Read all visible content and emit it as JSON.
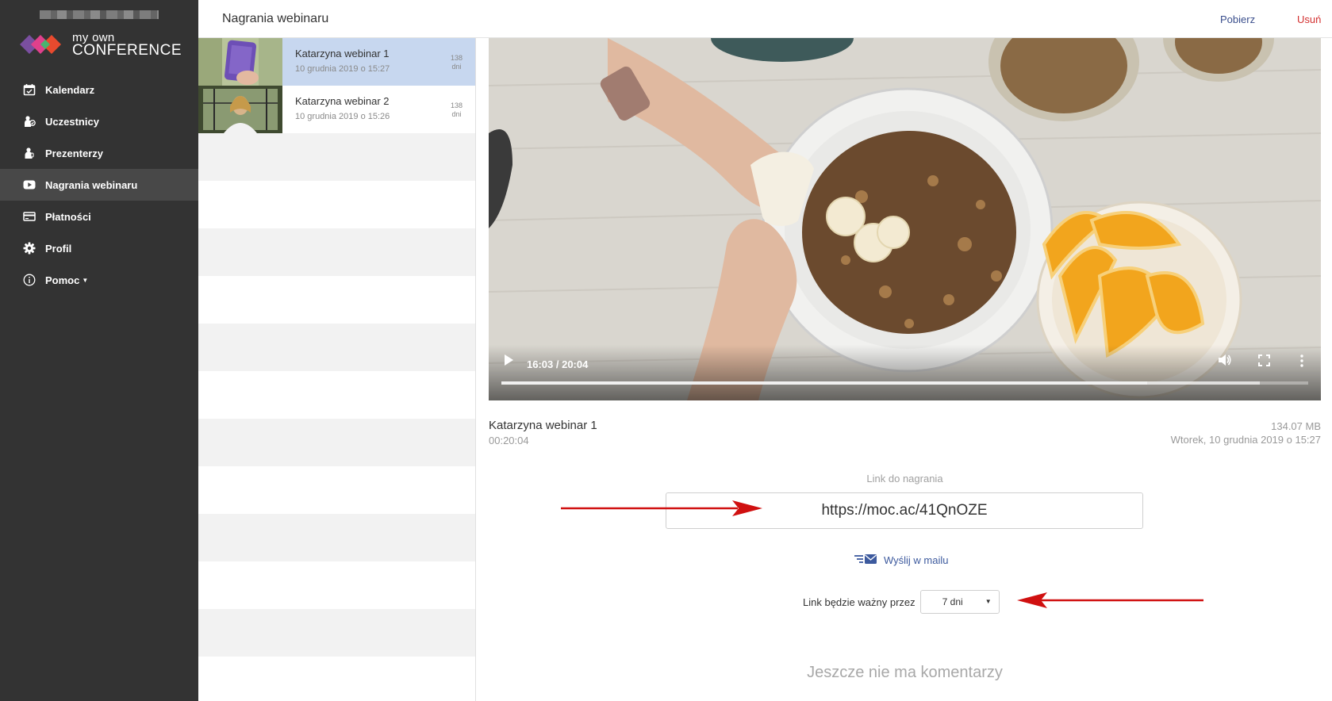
{
  "app": {
    "logo_small": "my own",
    "logo_big": "CONFERENCE"
  },
  "sidebar": {
    "items": [
      {
        "label": "Kalendarz",
        "icon": "calendar-icon"
      },
      {
        "label": "Uczestnicy",
        "icon": "participants-icon"
      },
      {
        "label": "Prezenterzy",
        "icon": "presenter-icon"
      },
      {
        "label": "Nagrania webinaru",
        "icon": "youtube-icon",
        "active": true
      },
      {
        "label": "Płatności",
        "icon": "credit-card-icon"
      },
      {
        "label": "Profil",
        "icon": "gear-icon"
      },
      {
        "label": "Pomoc",
        "icon": "info-icon",
        "has_dropdown": true
      }
    ]
  },
  "header": {
    "title": "Nagrania webinaru",
    "download_label": "Pobierz",
    "delete_label": "Usuń"
  },
  "recordings": [
    {
      "name": "Katarzyna webinar 1",
      "date": "10 grudnia 2019 o 15:27",
      "days_num": "138",
      "days_unit": "dni",
      "selected": true
    },
    {
      "name": "Katarzyna webinar 2",
      "date": "10 grudnia 2019 o 15:26",
      "days_num": "138",
      "days_unit": "dni",
      "selected": false
    }
  ],
  "player": {
    "time": "16:03 / 20:04",
    "progress_fraction": 0.8,
    "buffered_fraction": 0.94
  },
  "details": {
    "title": "Katarzyna webinar 1",
    "duration": "00:20:04",
    "size": "134.07 MB",
    "datetime": "Wtorek, 10 grudnia 2019 o 15:27"
  },
  "share": {
    "link_label": "Link do nagrania",
    "link_value": "https://moc.ac/41QnOZE",
    "send_mail_label": "Wyślij w mailu",
    "validity_label": "Link będzie ważny przez",
    "validity_value": "7 dni"
  },
  "comments": {
    "empty_text": "Jeszcze nie ma komentarzy"
  },
  "colors": {
    "sidebar_bg": "#333333",
    "sidebar_active": "#484848",
    "selected_row": "#c7d7ef",
    "link_blue": "#3d5a9e",
    "delete_red": "#d33030",
    "annotation_red": "#d01010"
  }
}
